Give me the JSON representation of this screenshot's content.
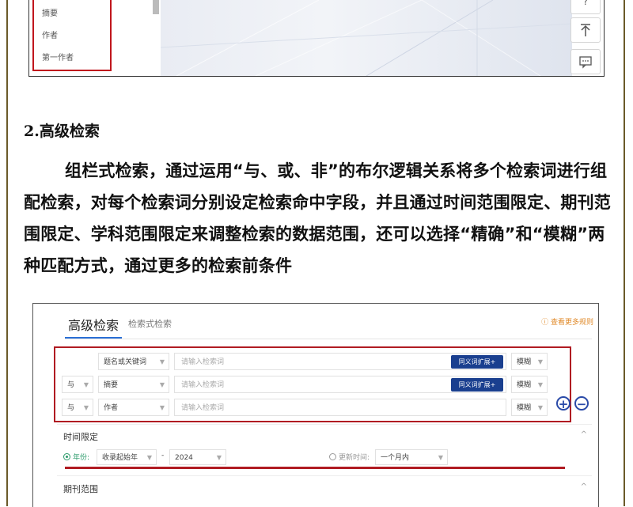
{
  "top_fragment": {
    "field_items": [
      "摘要",
      "作者",
      "第一作者"
    ]
  },
  "section": {
    "heading": "2.高级检索",
    "paragraph": "组栏式检索，通过运用“与、或、非”的布尔逻辑关系将多个检索词进行组配检索，对每个检索词分别设定检索命中字段，并且通过时间范围限定、期刊范围限定、学科范围限定来调整检索的数据范围，还可以选择“精确”和“模糊”两种匹配方式，通过更多的检索前条件"
  },
  "search_ui": {
    "tab_main": "高级检索",
    "tab_sub": "检索式检索",
    "rules_link": "ⓘ 查看更多规则",
    "rows": [
      {
        "logic": "",
        "field": "题名或关键词",
        "placeholder": "请输入检索词",
        "expand": "同义词扩展+",
        "match": "模糊"
      },
      {
        "logic": "与",
        "field": "摘要",
        "placeholder": "请输入检索词",
        "expand": "同义词扩展+",
        "match": "模糊"
      },
      {
        "logic": "与",
        "field": "作者",
        "placeholder": "请输入检索词",
        "expand": "",
        "match": "模糊"
      }
    ],
    "plus": "+",
    "minus": "−",
    "time_section": "时间限定",
    "year_label": "年份:",
    "year_start": "收录起始年",
    "dash": "-",
    "year_end": "2024",
    "update_label": "更新时间:",
    "update_value": "一个月内",
    "journal_section": "期刊范围",
    "chevron": "^",
    "colors": {
      "accent_red": "#b01b22",
      "button_blue": "#1a3f8f",
      "tab_blue": "#2a6fd6",
      "link_orange": "#e08a2a"
    }
  }
}
